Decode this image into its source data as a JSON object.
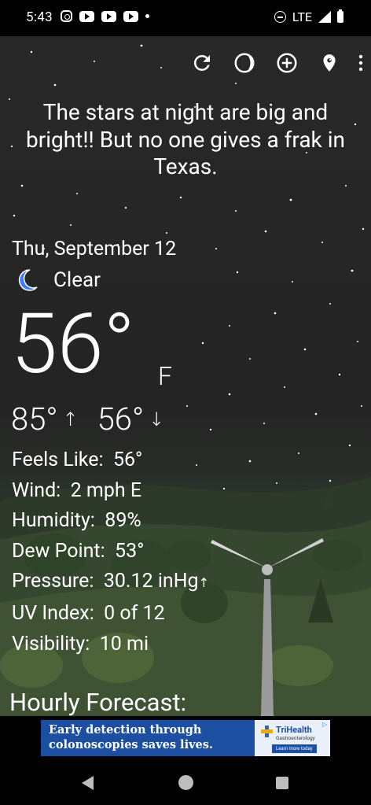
{
  "status_bar": {
    "time": "5:43",
    "network": "LTE",
    "notification_icons": [
      "instagram-icon",
      "youtube-icon",
      "youtube-icon",
      "youtube-icon"
    ]
  },
  "toolbar": {
    "actions": [
      "refresh-icon",
      "moon-phase-icon",
      "add-location-icon",
      "location-pin-icon",
      "more-vert-icon"
    ]
  },
  "quote": "The stars at night are big and bright!! But no one gives a frak in Texas.",
  "weather": {
    "date": "Thu, September 12",
    "condition": "Clear",
    "temperature": "56°",
    "unit": "F",
    "high": "85°",
    "low": "56°"
  },
  "details": {
    "feels_like_label": "Feels Like:",
    "feels_like": "56°",
    "wind_label": "Wind:",
    "wind": "2 mph E",
    "humidity_label": "Humidity:",
    "humidity": "89%",
    "dew_point_label": "Dew Point:",
    "dew_point": "53°",
    "pressure_label": "Pressure:",
    "pressure": "30.12 inHg",
    "uv_label": "UV Index:",
    "uv": "0 of 12",
    "visibility_label": "Visibility:",
    "visibility": "10 mi"
  },
  "hourly_heading": "Hourly Forecast:",
  "ad": {
    "headline_line1": "Early detection through",
    "headline_line2": "colonoscopies saves lives.",
    "brand": "TriHealth",
    "brand_sub": "Gastroenterology",
    "cta": "Learn more today"
  },
  "colors": {
    "ad_blue": "#1c4fa1",
    "moon_icon": "#3d7bff",
    "background": "#262626"
  }
}
